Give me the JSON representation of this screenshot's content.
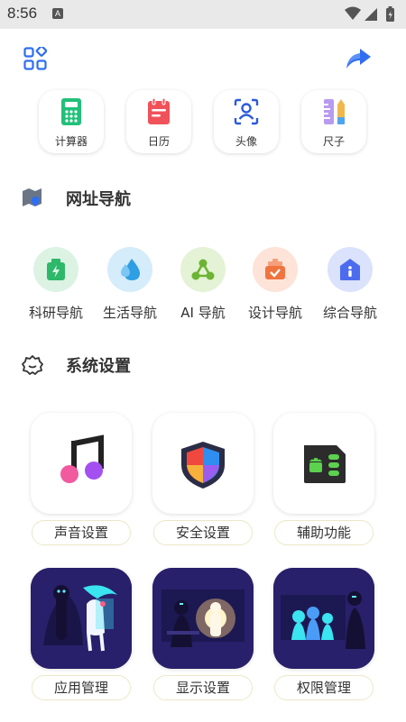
{
  "status_bar": {
    "time": "8:56",
    "notification_letter": "A"
  },
  "header": {
    "menu_icon": "grid-icon",
    "share_icon": "share-icon"
  },
  "tools": [
    {
      "label": "计算器",
      "icon": "calculator-icon",
      "color": "#22c07a"
    },
    {
      "label": "日历",
      "icon": "calendar-icon",
      "color": "#f0525a"
    },
    {
      "label": "头像",
      "icon": "avatar-scan-icon",
      "color": "#2d5bd8"
    },
    {
      "label": "尺子",
      "icon": "ruler-icon",
      "color": "#9b7fe8"
    }
  ],
  "nav_section": {
    "title": "网址导航",
    "items": [
      {
        "label": "科研导航",
        "icon": "battery-icon",
        "bg": "#dcf3e4",
        "color": "#2eb86a"
      },
      {
        "label": "生活导航",
        "icon": "water-drop-icon",
        "bg": "#d5ecfa",
        "color": "#2f9ee3"
      },
      {
        "label": "AI 导航",
        "icon": "share-nodes-icon",
        "bg": "#e4f2d6",
        "color": "#6cb434"
      },
      {
        "label": "设计导航",
        "icon": "box-check-icon",
        "bg": "#fde3d8",
        "color": "#f0743f"
      },
      {
        "label": "综合导航",
        "icon": "home-info-icon",
        "bg": "#dbe2fb",
        "color": "#4c6cf0"
      }
    ]
  },
  "settings_section": {
    "title": "系统设置",
    "items": [
      {
        "label": "声音设置",
        "icon": "music-note-icon"
      },
      {
        "label": "安全设置",
        "icon": "shield-icon"
      },
      {
        "label": "辅助功能",
        "icon": "android-sim-icon"
      },
      {
        "label": "应用管理",
        "icon": "illustration-app-icon"
      },
      {
        "label": "显示设置",
        "icon": "illustration-display-icon"
      },
      {
        "label": "权限管理",
        "icon": "illustration-permission-icon"
      }
    ]
  }
}
